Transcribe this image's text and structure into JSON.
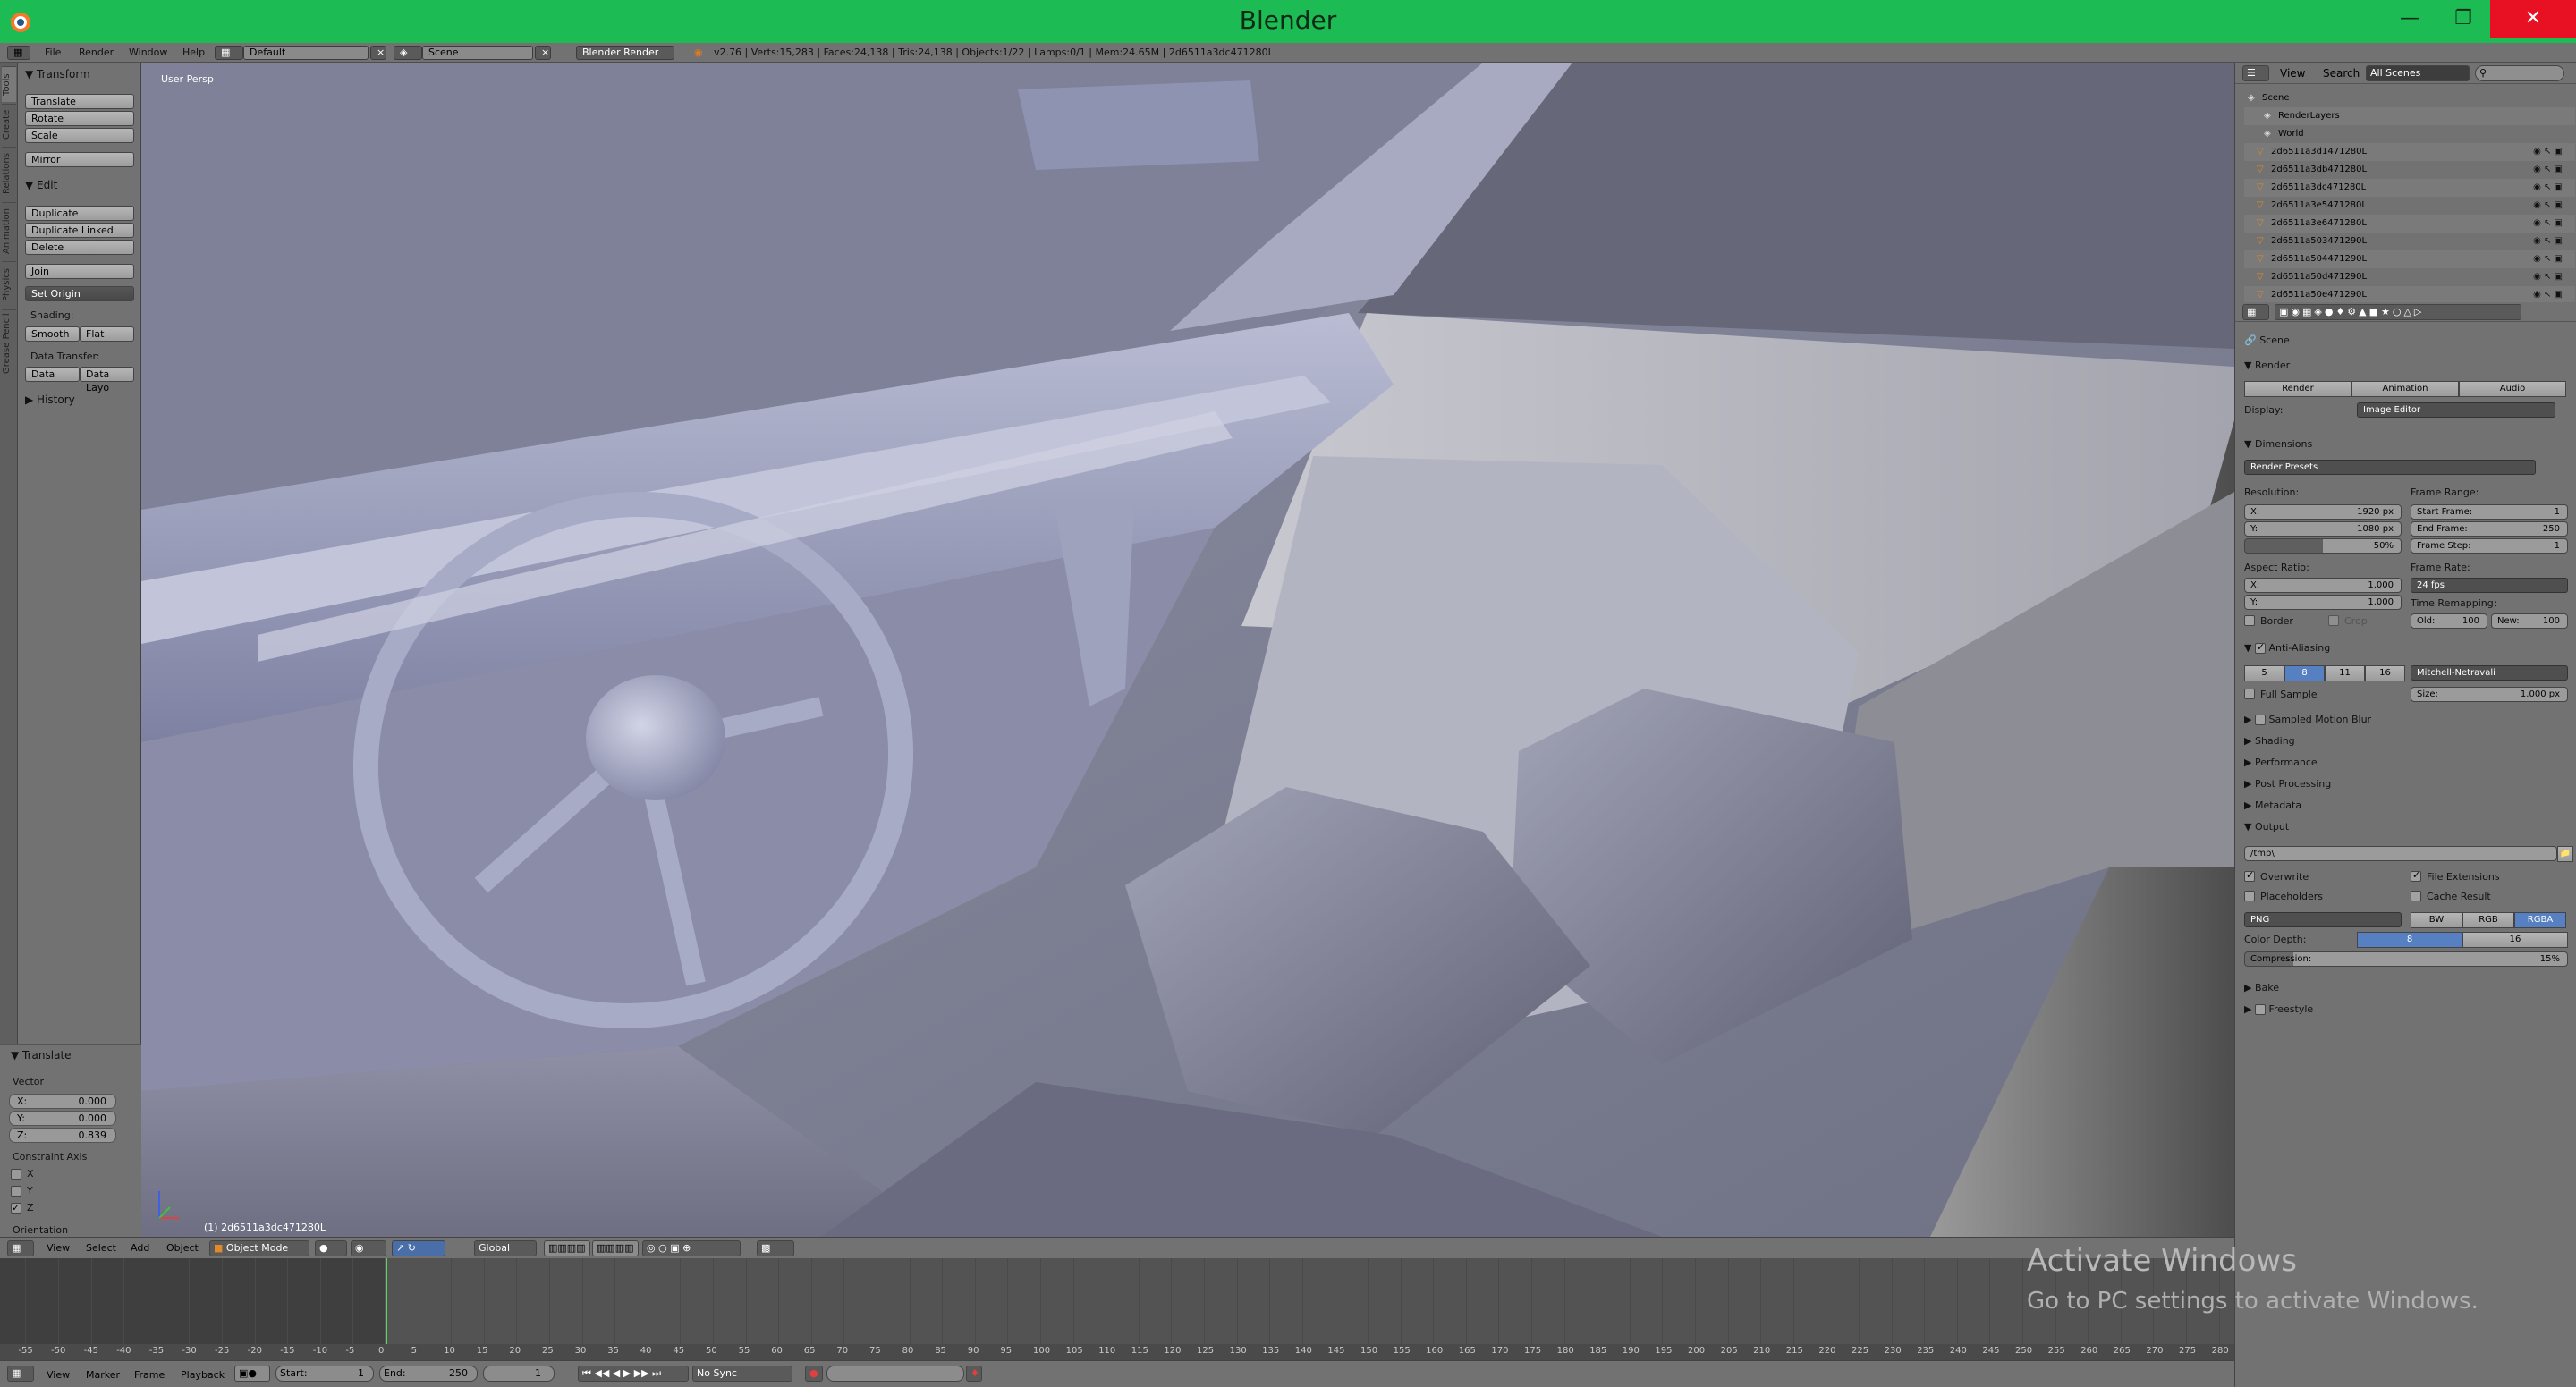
{
  "window": {
    "title": "Blender"
  },
  "infobar": {
    "menus": [
      "File",
      "Render",
      "Window",
      "Help"
    ],
    "layout": "Default",
    "scene": "Scene",
    "engine": "Blender Render",
    "stats": "v2.76 | Verts:15,283 | Faces:24,138 | Tris:24,138 | Objects:1/22 | Lamps:0/1 | Mem:24.65M | 2d6511a3dc471280L"
  },
  "tool_tabs": [
    "Tools",
    "Create",
    "Relations",
    "Animation",
    "Physics",
    "Grease Pencil"
  ],
  "tools": {
    "transform_header": "Transform",
    "translate": "Translate",
    "rotate": "Rotate",
    "scale": "Scale",
    "mirror": "Mirror",
    "edit_header": "Edit",
    "duplicate": "Duplicate",
    "duplicate_linked": "Duplicate Linked",
    "delete": "Delete",
    "join": "Join",
    "set_origin": "Set Origin",
    "shading_label": "Shading:",
    "smooth": "Smooth",
    "flat": "Flat",
    "data_transfer_label": "Data Transfer:",
    "data": "Data",
    "data_layout": "Data Layo",
    "history_header": "History"
  },
  "redo_panel": {
    "header": "Translate",
    "vector_label": "Vector",
    "x_label": "X:",
    "x": "0.000",
    "y_label": "Y:",
    "y": "0.000",
    "z_label": "Z:",
    "z": "0.839",
    "constraint_label": "Constraint Axis",
    "cx": "X",
    "cy": "Y",
    "cz": "Z",
    "orientation_label": "Orientation"
  },
  "viewport": {
    "view_label": "User Persp",
    "object_label": "(1) 2d6511a3dc471280L"
  },
  "view3d_header": {
    "view": "View",
    "select": "Select",
    "add": "Add",
    "object": "Object",
    "mode": "Object Mode",
    "orientation": "Global"
  },
  "timeline": {
    "ticks": [
      "-55",
      "-50",
      "-45",
      "-40",
      "-35",
      "-30",
      "-25",
      "-20",
      "-15",
      "-10",
      "-5",
      "0",
      "5",
      "10",
      "15",
      "20",
      "25",
      "30",
      "35",
      "40",
      "45",
      "50",
      "55",
      "60",
      "65",
      "70",
      "75",
      "80",
      "85",
      "90",
      "95",
      "100",
      "105",
      "110",
      "115",
      "120",
      "125",
      "130",
      "135",
      "140",
      "145",
      "150",
      "155",
      "160",
      "165",
      "170",
      "175",
      "180",
      "185",
      "190",
      "195",
      "200",
      "205",
      "210",
      "215",
      "220",
      "225",
      "230",
      "235",
      "240",
      "245",
      "250",
      "255",
      "260",
      "265",
      "270",
      "275",
      "280"
    ],
    "current_frame_marker": "0"
  },
  "timeline_header": {
    "view": "View",
    "marker": "Marker",
    "frame": "Frame",
    "playback": "Playback",
    "start_label": "Start:",
    "start": "1",
    "end_label": "End:",
    "end": "250",
    "current": "1",
    "sync": "No Sync"
  },
  "outliner": {
    "view": "View",
    "search": "Search",
    "filter": "All Scenes",
    "rows": [
      "Scene",
      "RenderLayers",
      "World",
      "2d6511a3d1471280L",
      "2d6511a3db471280L",
      "2d6511a3dc471280L",
      "2d6511a3e5471280L",
      "2d6511a3e6471280L",
      "2d6511a503471290L",
      "2d6511a504471290L",
      "2d6511a50d471290L",
      "2d6511a50e471290L"
    ]
  },
  "properties": {
    "breadcrumb": "Scene",
    "render_header": "Render",
    "render_btn": "Render",
    "animation_btn": "Animation",
    "audio_btn": "Audio",
    "display_label": "Display:",
    "display_value": "Image Editor",
    "dimensions_header": "Dimensions",
    "render_presets": "Render Presets",
    "resolution_label": "Resolution:",
    "res_x_label": "X:",
    "res_x": "1920 px",
    "res_y_label": "Y:",
    "res_y": "1080 px",
    "res_pct": "50%",
    "frame_range_label": "Frame Range:",
    "start_frame_label": "Start Frame:",
    "start_frame": "1",
    "end_frame_label": "End Frame:",
    "end_frame": "250",
    "frame_step_label": "Frame Step:",
    "frame_step": "1",
    "aspect_label": "Aspect Ratio:",
    "asp_x_label": "X:",
    "asp_x": "1.000",
    "asp_y_label": "Y:",
    "asp_y": "1.000",
    "frame_rate_label": "Frame Rate:",
    "frame_rate": "24 fps",
    "time_remap_label": "Time Remapping:",
    "old_label": "Old:",
    "old": "100",
    "new_label": "New:",
    "new": "100",
    "border": "Border",
    "crop": "Crop",
    "aa_header": "Anti-Aliasing",
    "aa_5": "5",
    "aa_8": "8",
    "aa_11": "11",
    "aa_16": "16",
    "filter": "Mitchell-Netravali",
    "full_sample": "Full Sample",
    "size_label": "Size:",
    "size": "1.000 px",
    "motion_blur": "Sampled Motion Blur",
    "shading": "Shading",
    "performance": "Performance",
    "post_processing": "Post Processing",
    "metadata": "Metadata",
    "output_header": "Output",
    "output_path": "/tmp\\",
    "overwrite": "Overwrite",
    "file_ext": "File Extensions",
    "placeholders": "Placeholders",
    "cache_result": "Cache Result",
    "format": "PNG",
    "bw": "BW",
    "rgb": "RGB",
    "rgba": "RGBA",
    "color_depth_label": "Color Depth:",
    "depth_8": "8",
    "depth_16": "16",
    "compression_label": "Compression:",
    "compression": "15%",
    "bake": "Bake",
    "freestyle": "Freestyle"
  },
  "watermark": {
    "line1": "Activate Windows",
    "line2": "Go to PC settings to activate Windows."
  }
}
